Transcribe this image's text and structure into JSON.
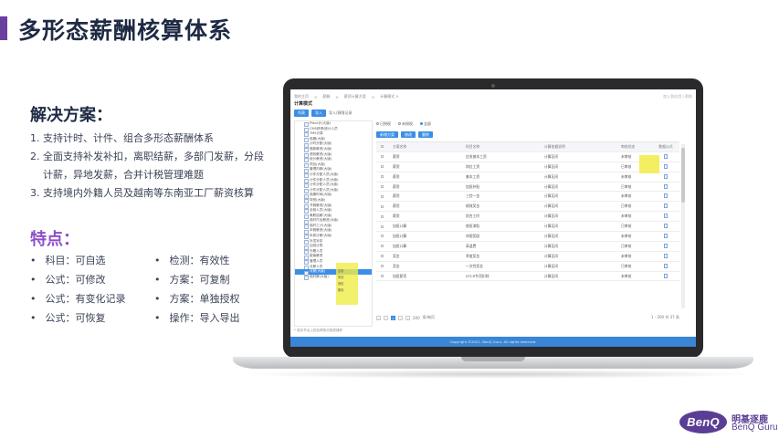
{
  "slide": {
    "title": "多形态薪酬核算体系",
    "solution_heading": "解决方案：",
    "solutions": [
      {
        "num": "1.",
        "text": "支持计时、计件、组合多形态薪酬体系"
      },
      {
        "num": "2.",
        "text": "全面支持补发补扣，离职结薪，多部门发薪，分段计薪，异地发薪，合并计税管理难题"
      },
      {
        "num": "3.",
        "text": "支持境内外籍人员及越南等东南亚工厂薪资核算"
      }
    ],
    "features_heading": "特点：",
    "features": [
      "科目：可自选",
      "检测：有效性",
      "公式：可修改",
      "方案：可复制",
      "公式：有变化记录",
      "方案：单独授权",
      "公式：可恢复",
      "操作：导入导出"
    ]
  },
  "screen": {
    "breadcrumb": [
      "我的主页",
      ">",
      "薪酬",
      ">",
      "薪资计算方案",
      ">",
      "计算模式 ×"
    ],
    "breadcrumb_right": "加入到应用 | 帮助",
    "window_title": "计算模式",
    "tab_active": "列表",
    "tab_import": "导入",
    "tab_import_label": "导入/源限记录",
    "tree_items": [
      "Piece计(大版)",
      "CMS获得/统计人员",
      "TMS计算",
      "临期(大版)",
      "计时分配(大版)",
      "借款薪资(大版)",
      "绩效薪资(大版)",
      "统计薪资(大版)",
      "项目(大版)",
      "管理内精(大版)",
      "计件分配人员(大版)",
      "计件分配人员(大版)",
      "计件分配人员(大版)",
      "计件分配人员(大版)",
      "临期时间(大版)",
      "特别(大版)",
      "节假薪资(大版)",
      "全勤人员(大版)",
      "离职结薪(大版)",
      "临时付出薪资(大版)",
      "临时工计(大版)",
      "年假薪资(大版)",
      "年底计薪(大版)",
      "补发补扣",
      "加班计算",
      "外籍人员",
      "越南薪资",
      "管理人员",
      "月薪人员",
      "月薪(大版)",
      "临时薪(大版)"
    ],
    "tree_selected_index": 29,
    "context_menu": [
      "复制",
      "修改",
      "授权",
      "删除"
    ],
    "filters": [
      "已授权",
      "未授权",
      "全部"
    ],
    "filter_selected": 2,
    "actions": [
      "新增方案",
      "修改",
      "删除"
    ],
    "columns": [
      "方案名称",
      "科目名称",
      "计算依据说明",
      "审核状态",
      "数据公式"
    ],
    "rows": [
      [
        "薪资",
        "应发基本工资",
        "计算区间",
        "未审核"
      ],
      [
        "薪资",
        "岗位工资",
        "计算区间",
        "已审核"
      ],
      [
        "薪资",
        "基本工资",
        "计算区间",
        "未审核"
      ],
      [
        "薪资",
        "加班补贴",
        "计算区间",
        "已审核"
      ],
      [
        "薪资",
        "三险一金",
        "计算区间",
        "未审核"
      ],
      [
        "薪资",
        "绩效奖金",
        "计算区间",
        "已审核"
      ],
      [
        "薪资",
        "综合工时",
        "计算区间",
        "未审核"
      ],
      [
        "加班计算",
        "夜班津贴",
        "计算区间",
        "已审核"
      ],
      [
        "加班计算",
        "休假奖励",
        "计算区间",
        "未审核"
      ],
      [
        "加班计算",
        "高温费",
        "计算区间",
        "已审核"
      ],
      [
        "奖金",
        "季度奖金",
        "计算区间",
        "未审核"
      ],
      [
        "奖金",
        "一次性奖金",
        "计算区间",
        "已审核"
      ],
      [
        "加班薪资",
        "DTCR专项扣除",
        "计算区间",
        "未审核"
      ]
    ],
    "pager_size": "200",
    "pager_label": "条/每页",
    "pager_summary": "1 - 200 共 37 条",
    "note": "* 双击节点上的名称执行相关操作",
    "footer": "Copyright ©2021. BenQ Guru. All rights reserved."
  },
  "logo": {
    "mark": "BenQ",
    "cn": "明基逐鹿",
    "en": "BenQ Guru",
    "color": "#5a3e96"
  },
  "colors": {
    "accent": "#6a3fa0",
    "feature_heading": "#8e4fc9",
    "app_blue": "#3a8ee6",
    "highlight": "#f0ec46"
  }
}
